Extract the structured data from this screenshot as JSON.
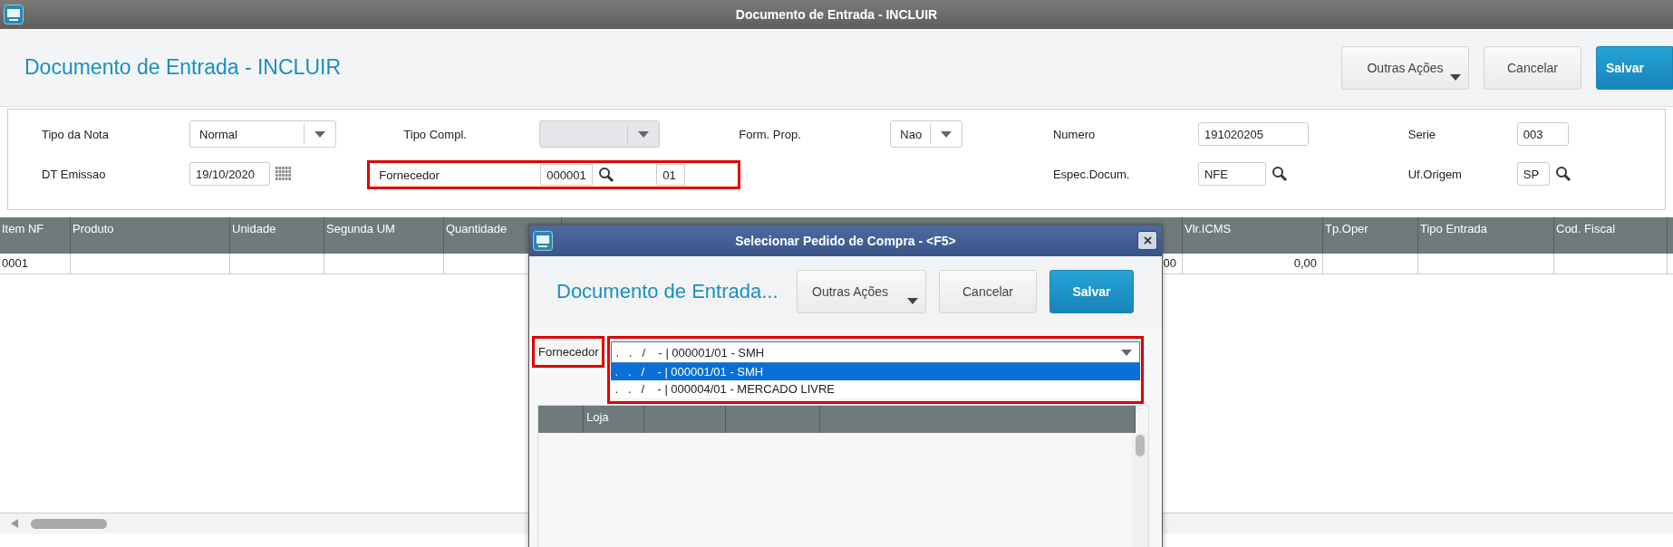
{
  "window": {
    "title": "Documento de Entrada - INCLUIR"
  },
  "header": {
    "title": "Documento de Entrada - INCLUIR",
    "buttons": [
      {
        "label": "Outras Ações",
        "kind": "menu"
      },
      {
        "label": "Cancelar",
        "kind": "default"
      },
      {
        "label": "Salvar",
        "kind": "primary"
      }
    ]
  },
  "form": {
    "columns": [
      {
        "fields": [
          {
            "label": "Tipo da Nota",
            "kind": "select",
            "value": "Normal",
            "disabled": false
          },
          {
            "label": "DT Emissao",
            "kind": "date",
            "value": "19/10/2020"
          }
        ]
      },
      {
        "fields": [
          {
            "label": "Tipo Compl.",
            "kind": "select",
            "disabled": true
          },
          {
            "label": "Fornecedor",
            "kind": "supplier",
            "value": "000001",
            "store": "01",
            "highlighted": true
          }
        ]
      },
      {
        "fields": [
          {
            "label": "Form. Prop.",
            "kind": "select",
            "value": "Nao",
            "disabled": false
          }
        ]
      },
      {
        "fields": [
          {
            "label": "Numero",
            "kind": "text",
            "value": "191020205"
          },
          {
            "label": "Espec.Docum.",
            "kind": "lookup",
            "value": "NFE"
          }
        ]
      },
      {
        "fields": [
          {
            "label": "Serie",
            "kind": "text",
            "value": "003"
          },
          {
            "label": "Uf.Origem",
            "kind": "lookup",
            "value": "SP"
          }
        ]
      }
    ]
  },
  "table": {
    "columns": [
      "Item NF",
      "Produto",
      "Unidade",
      "Segunda UM",
      "Quantidade",
      null,
      "Vlr.ICMS",
      "Tp.Oper",
      "Tipo Entrada",
      "Cod. Fiscal"
    ],
    "rows": [
      {
        "cells": [
          "0001",
          null,
          null,
          null,
          null,
          "00",
          "0,00",
          null,
          null,
          null
        ]
      }
    ]
  },
  "dialog": {
    "title": "Selecionar Pedido de Compra - <F5>",
    "header_title": "Documento de Entrada...",
    "buttons": [
      {
        "label": "Outras Ações",
        "kind": "menu"
      },
      {
        "label": "Cancelar",
        "kind": "default"
      },
      {
        "label": "Salvar",
        "kind": "primary"
      }
    ],
    "supplier": {
      "label": "Fornecedor",
      "label_highlighted": true,
      "value": ".   .   /    - | 000001/01 - SMH",
      "highlighted": true,
      "expanded": true,
      "options": [
        {
          "label": ".   .   /    - | 000001/01 - SMH",
          "selected": true
        },
        {
          "label": ".   .   /    - | 000004/01 - MERCADO LIVRE",
          "selected": false
        }
      ]
    },
    "grid": {
      "columns": [
        null,
        "Loja",
        null,
        null,
        null
      ]
    }
  }
}
